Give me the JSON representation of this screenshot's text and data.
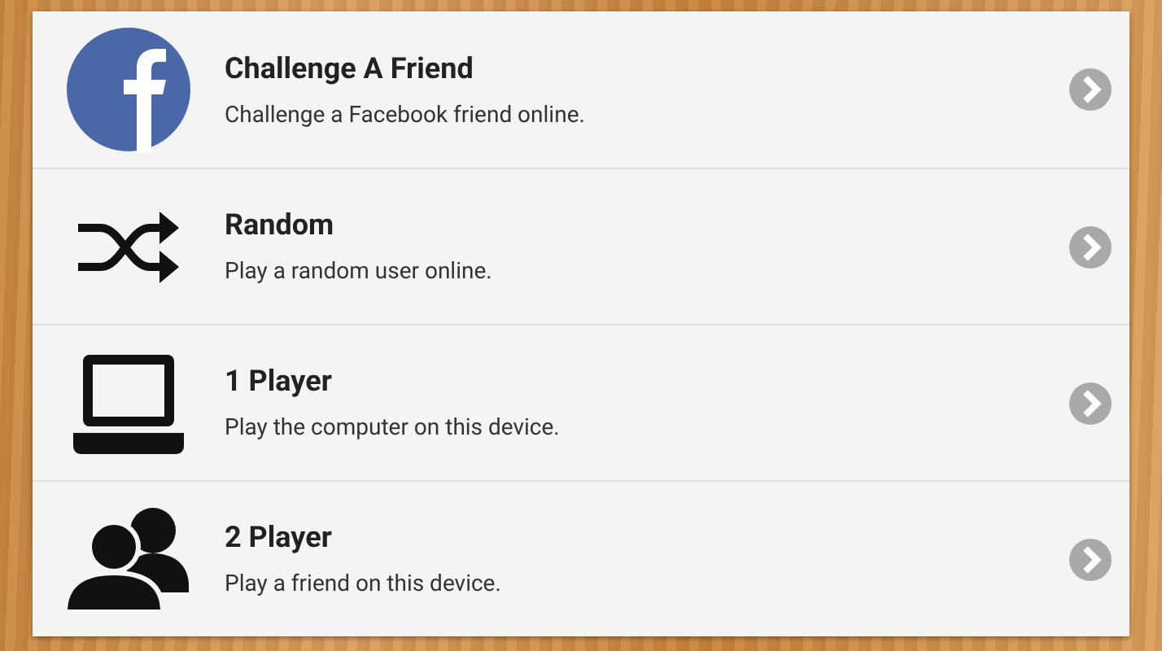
{
  "menu": {
    "items": [
      {
        "kind": "social",
        "title": "Challenge A Friend",
        "subtitle": "Challenge a Facebook friend online."
      },
      {
        "kind": "shuffle",
        "title": "Random",
        "subtitle": "Play a random user online."
      },
      {
        "kind": "laptop",
        "title": "1 Player",
        "subtitle": "Play the computer on this device."
      },
      {
        "kind": "people",
        "title": "2 Player",
        "subtitle": "Play a friend on this device."
      }
    ]
  }
}
